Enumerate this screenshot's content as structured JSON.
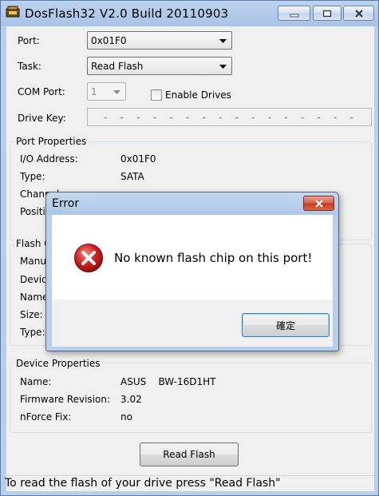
{
  "window": {
    "title": "DosFlash32 V2.0 Build 20110903"
  },
  "form": {
    "port_label": "Port:",
    "port_value": "0x01F0",
    "task_label": "Task:",
    "task_value": "Read Flash",
    "com_label": "COM Port:",
    "com_value": "1",
    "enable_drives_label": "Enable Drives",
    "drive_key_label": "Drive Key:",
    "drive_key_mask": [
      "-",
      "-",
      "-",
      "-",
      "-",
      "-",
      "-",
      "-",
      "-",
      "-",
      "-",
      "-",
      "-",
      "-",
      "-",
      "-"
    ]
  },
  "port_properties": {
    "title": "Port Properties",
    "rows": [
      {
        "label": "I/O Address:",
        "value": "0x01F0"
      },
      {
        "label": "Type:",
        "value": "SATA"
      },
      {
        "label": "Channel",
        "value": ""
      },
      {
        "label": "Positio",
        "value": ""
      }
    ]
  },
  "flash_chip": {
    "title": "Flash C",
    "rows": [
      "Manuf",
      "Device",
      "Name",
      "Size:",
      "Type:"
    ]
  },
  "device_properties": {
    "title": "Device Properties",
    "rows": [
      {
        "label": "Name:",
        "value": "ASUS    BW-16D1HT"
      },
      {
        "label": "Firmware Revision:",
        "value": "3.02"
      },
      {
        "label": "nForce Fix:",
        "value": "no"
      }
    ]
  },
  "read_flash_button": "Read Flash",
  "status_text": "To read the flash of your drive press \"Read Flash\"",
  "dialog": {
    "title": "Error",
    "message": "No known flash chip on this port!",
    "ok_label": "確定",
    "icon": "error-x-icon"
  },
  "colors": {
    "error_red": "#d22323",
    "title_blue": "#b9cfec"
  }
}
